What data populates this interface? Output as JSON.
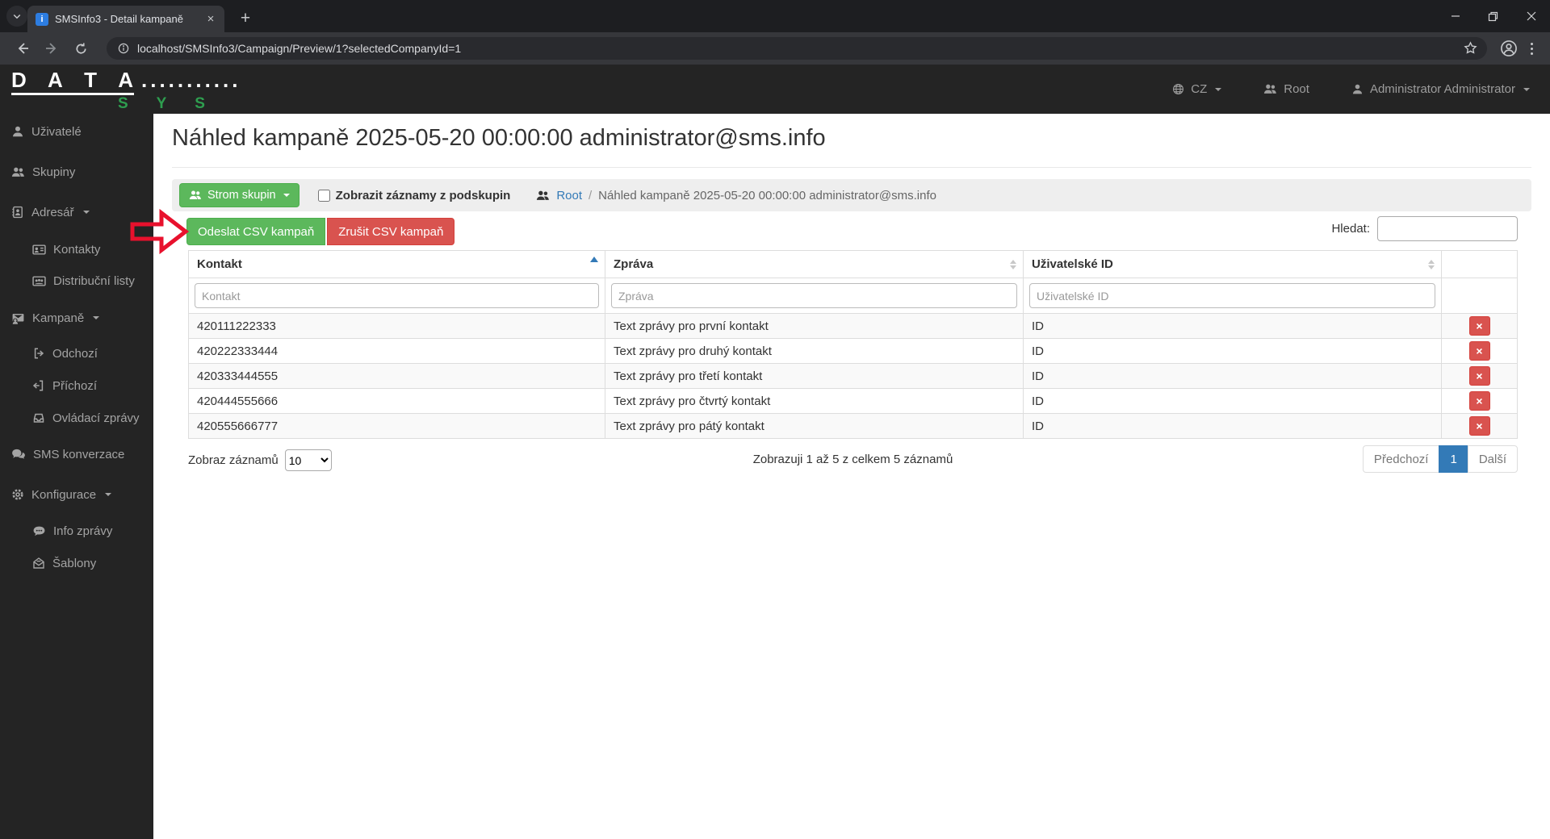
{
  "browser": {
    "tab_title": "SMSInfo3 - Detail kampaně",
    "favicon_text": "i",
    "url": "localhost/SMSInfo3/Campaign/Preview/1?selectedCompanyId=1"
  },
  "header": {
    "logo_main": "D A T A",
    "logo_dots": "...........",
    "logo_sub": "S Y S",
    "language": "CZ",
    "group": "Root",
    "user": "Administrator Administrator"
  },
  "sidebar": {
    "items": [
      {
        "label": "Uživatelé"
      },
      {
        "label": "Skupiny"
      },
      {
        "label": "Adresář"
      },
      {
        "label": "Kontakty"
      },
      {
        "label": "Distribuční listy"
      },
      {
        "label": "Kampaně"
      },
      {
        "label": "Odchozí"
      },
      {
        "label": "Příchozí"
      },
      {
        "label": "Ovládací zprávy"
      },
      {
        "label": "SMS konverzace"
      },
      {
        "label": "Konfigurace"
      },
      {
        "label": "Info zprávy"
      },
      {
        "label": "Šablony"
      }
    ]
  },
  "main": {
    "page_title": "Náhled kampaně 2025-05-20 00:00:00 administrator@sms.info",
    "toolbar": {
      "tree_button_label": "Strom skupin",
      "subgroup_checkbox_label": "Zobrazit záznamy z podskupin",
      "breadcrumb_root": "Root",
      "breadcrumb_separator": "/",
      "breadcrumb_current": "Náhled kampaně 2025-05-20 00:00:00 administrator@sms.info"
    },
    "actions": {
      "send_csv_label": "Odeslat CSV kampaň",
      "cancel_csv_label": "Zrušit CSV kampaň"
    },
    "search": {
      "label": "Hledat:",
      "value": ""
    },
    "table": {
      "columns": [
        "Kontakt",
        "Zpráva",
        "Uživatelské ID"
      ],
      "filter_placeholders": [
        "Kontakt",
        "Zpráva",
        "Uživatelské ID"
      ],
      "rows": [
        {
          "kontakt": "420111222333",
          "zprava": "Text zprávy pro první kontakt",
          "uzivatelske_id": "ID"
        },
        {
          "kontakt": "420222333444",
          "zprava": "Text zprávy pro druhý kontakt",
          "uzivatelske_id": "ID"
        },
        {
          "kontakt": "420333444555",
          "zprava": "Text zprávy pro třetí kontakt",
          "uzivatelske_id": "ID"
        },
        {
          "kontakt": "420444555666",
          "zprava": "Text zprávy pro čtvrtý kontakt",
          "uzivatelske_id": "ID"
        },
        {
          "kontakt": "420555666777",
          "zprava": "Text zprávy pro pátý kontakt",
          "uzivatelske_id": "ID"
        }
      ]
    },
    "footer": {
      "length_label": "Zobraz záznamů",
      "length_value": "10",
      "info": "Zobrazuji 1 až 5 z celkem 5 záznamů",
      "prev_label": "Předchozí",
      "current_page": "1",
      "next_label": "Další"
    }
  },
  "colors": {
    "success_green": "#5cb85c",
    "success_border": "#4cae4c",
    "danger_red": "#d9534f",
    "link_blue": "#337ab7",
    "annotation_red": "#e8112d",
    "logo_green": "#2e9e4f",
    "chrome_dark": "#242424"
  }
}
